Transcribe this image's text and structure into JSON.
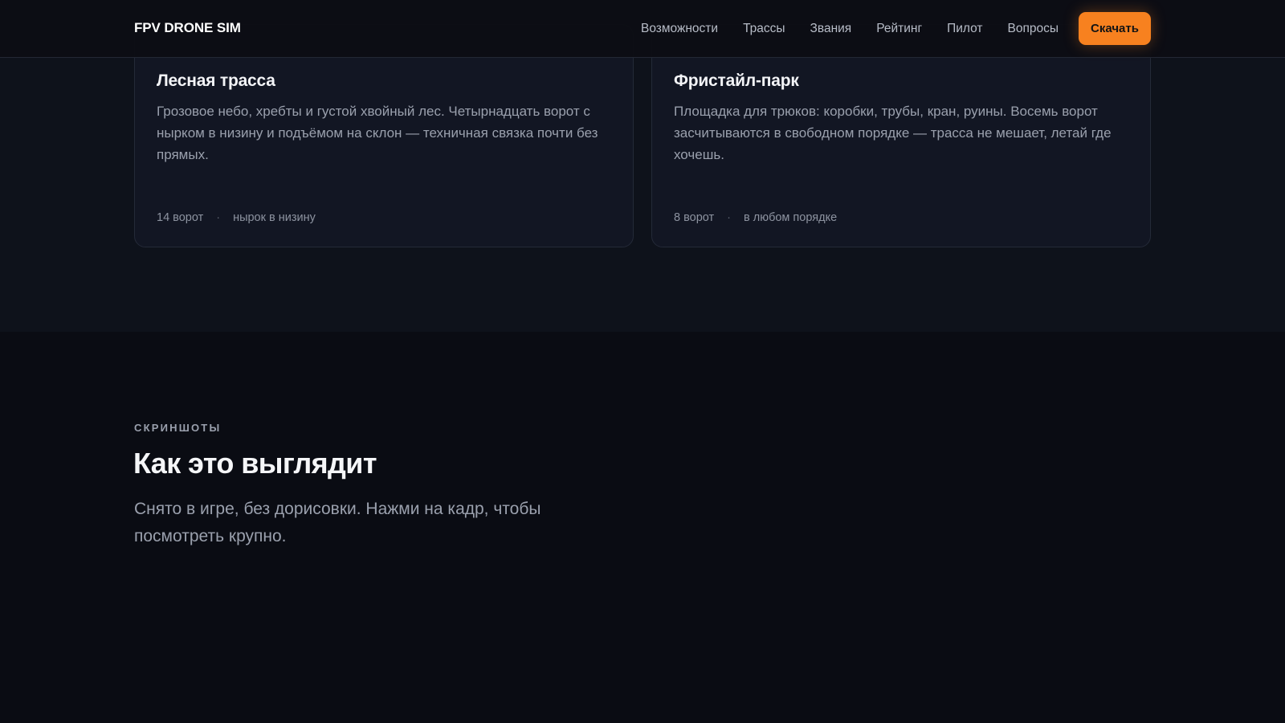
{
  "header": {
    "logo": "FPV DRONE SIM",
    "nav": [
      "Возможности",
      "Трассы",
      "Звания",
      "Рейтинг",
      "Пилот",
      "Вопросы"
    ],
    "download_label": "Скачать",
    "accent_color": "#f7811f"
  },
  "tracks": [
    {
      "title": "Лесная трасса",
      "description": "Грозовое небо, хребты и густой хвойный лес. Четырнадцать ворот с нырком в низину и подъёмом на склон — техничная связка почти без прямых.",
      "gates": "14 ворот",
      "feature": "нырок в низину"
    },
    {
      "title": "Фристайл-парк",
      "description": "Площадка для трюков: коробки, трубы, кран, руины. Восемь ворот засчитываются в свободном порядке — трасса не мешает, летай где хочешь.",
      "gates": "8 ворот",
      "feature": "в любом порядке"
    }
  ],
  "screenshots": {
    "eyebrow": "СКРИНШОТЫ",
    "title": "Как это выглядит",
    "subtitle": "Снято в игре, без дорисовки. Нажми на кадр, чтобы посмотреть крупно."
  }
}
